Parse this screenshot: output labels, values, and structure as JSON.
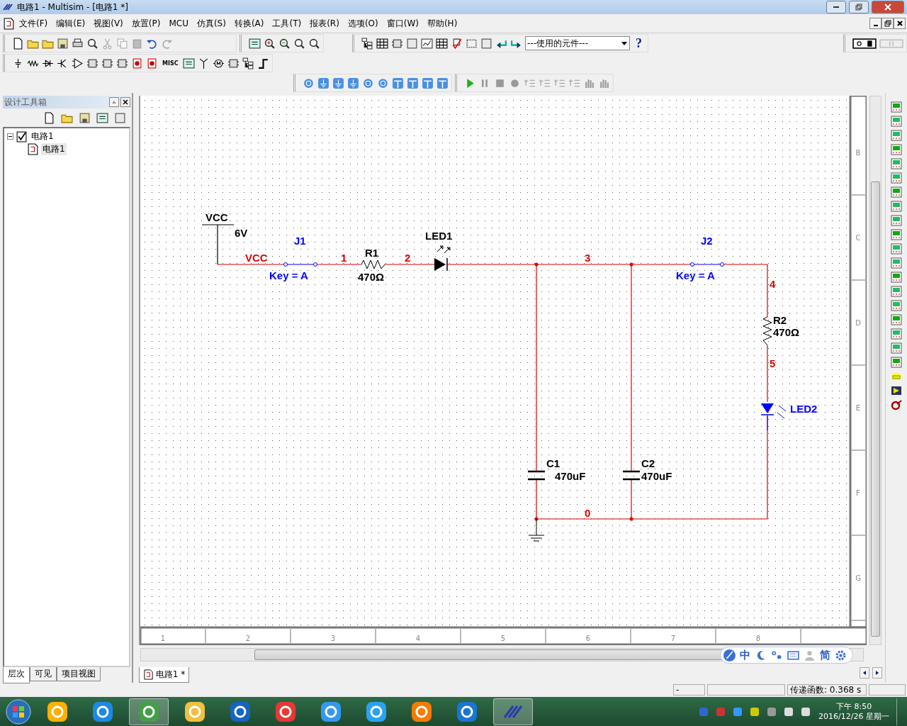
{
  "window": {
    "title": "电路1 - Multisim - [电路1 *]"
  },
  "menu": [
    "文件(F)",
    "编辑(E)",
    "视图(V)",
    "放置(P)",
    "MCU",
    "仿真(S)",
    "转换(A)",
    "工具(T)",
    "报表(R)",
    "选项(O)",
    "窗口(W)",
    "帮助(H)"
  ],
  "component_combo": {
    "value": "---使用的元件---"
  },
  "help_button": "?",
  "misc_label": "MISC",
  "design_toolbox": {
    "title": "设计工具箱",
    "tree": [
      {
        "label": "电路1",
        "checked": true,
        "expanded": true,
        "children": [
          {
            "label": "电路1",
            "selected": true
          }
        ]
      }
    ],
    "tabs": [
      {
        "label": "层次",
        "selected": true
      },
      {
        "label": "可见",
        "selected": false
      },
      {
        "label": "项目视图",
        "selected": false
      }
    ]
  },
  "schematic": {
    "vcc": {
      "label": "VCC",
      "voltage": "6V",
      "net": "VCC"
    },
    "switches": [
      {
        "ref": "J1",
        "key": "Key = A"
      },
      {
        "ref": "J2",
        "key": "Key = A"
      }
    ],
    "resistors": [
      {
        "ref": "R1",
        "value": "470Ω"
      },
      {
        "ref": "R2",
        "value": "470Ω"
      }
    ],
    "leds": [
      {
        "ref": "LED1"
      },
      {
        "ref": "LED2"
      }
    ],
    "capacitors": [
      {
        "ref": "C1",
        "value": "470uF"
      },
      {
        "ref": "C2",
        "value": "470uF"
      }
    ],
    "nets": [
      "1",
      "2",
      "3",
      "4",
      "5",
      "0"
    ],
    "row_labels": [
      "B",
      "C",
      "D",
      "E",
      "F",
      "G"
    ],
    "column_labels": [
      "1",
      "2",
      "3",
      "4",
      "5",
      "6",
      "7",
      "8"
    ]
  },
  "document_tabs": [
    {
      "label": "电路1 *",
      "selected": true
    }
  ],
  "ime_bar": {
    "mode": "中",
    "script": "简"
  },
  "status_bar": [
    "-",
    "传递函数: 0.368 s"
  ],
  "taskbar": {
    "time": "下午 8:50",
    "date": "2016/12/26 星期一"
  }
}
